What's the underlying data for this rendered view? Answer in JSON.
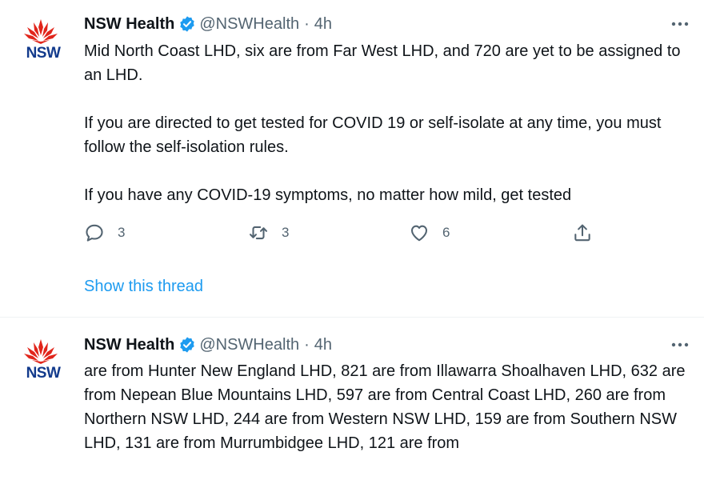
{
  "tweets": [
    {
      "author": "NSW Health",
      "handle": "@NSWHealth",
      "separator": "·",
      "time": "4h",
      "logo_text": "NSW",
      "paragraphs": [
        "Mid North Coast LHD, six are from Far West LHD, and 720 are yet to be assigned to an LHD.",
        "If you are directed to get tested for COVID 19 or self-isolate at any time, you must follow the self-isolation rules.",
        "If you have any COVID-19 symptoms, no matter how mild, get tested"
      ],
      "actions": {
        "replies": "3",
        "retweets": "3",
        "likes": "6"
      },
      "show_thread": "Show this thread"
    },
    {
      "author": "NSW Health",
      "handle": "@NSWHealth",
      "separator": "·",
      "time": "4h",
      "logo_text": "NSW",
      "paragraphs": [
        "are from Hunter New England LHD, 821 are from Illawarra Shoalhaven LHD, 632 are from Nepean Blue Mountains LHD, 597 are from Central Coast LHD, 260 are from Northern NSW LHD, 244 are from Western NSW LHD, 159 are from Southern NSW LHD, 131 are from Murrumbidgee LHD, 121 are from"
      ]
    }
  ],
  "colors": {
    "logo_red": "#e1251b",
    "logo_blue": "#123a8c",
    "verified_blue": "#1d9bf0",
    "link_blue": "#1d9bf0",
    "muted": "#536471"
  }
}
